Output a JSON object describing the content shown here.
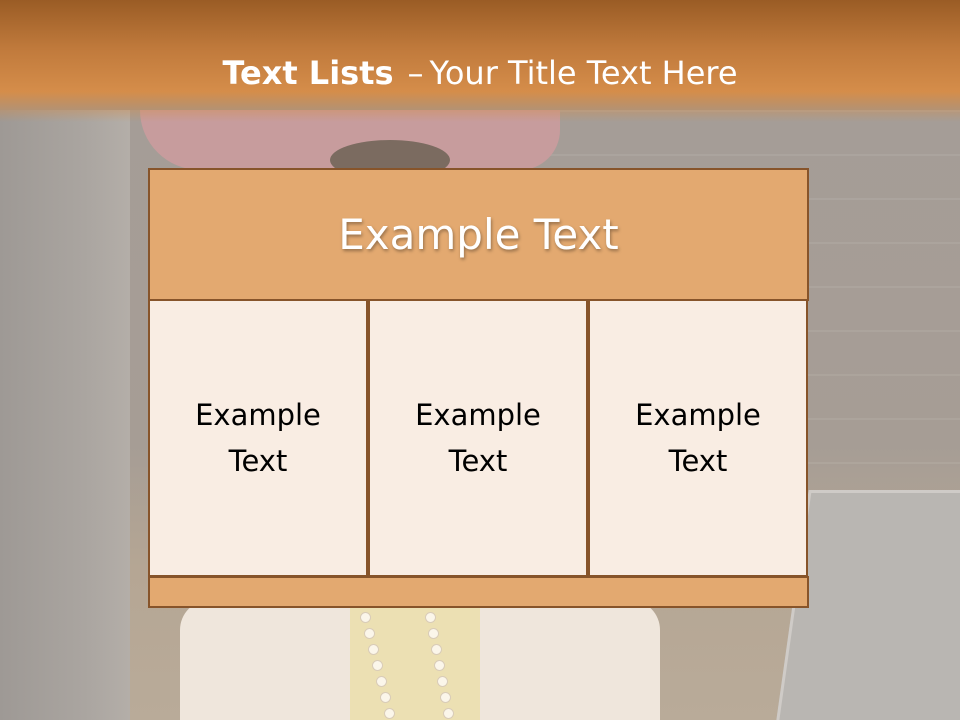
{
  "slide": {
    "title_bold": "Text Lists",
    "title_dash": "–",
    "title_rest": "Your Title Text Here"
  },
  "diagram": {
    "header": "Example Text",
    "columns": [
      {
        "label": "Example Text"
      },
      {
        "label": "Example Text"
      },
      {
        "label": "Example Text"
      }
    ]
  },
  "colors": {
    "title_bar": "#c07a3c",
    "header_fill": "#e3a970",
    "column_fill": "#f9ede3",
    "border": "#87542a"
  }
}
